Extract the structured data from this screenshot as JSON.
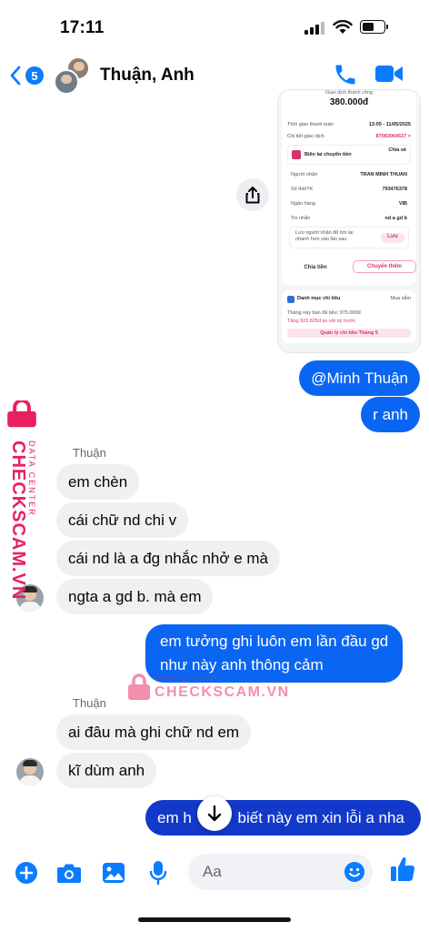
{
  "status_bar": {
    "time": "17:11"
  },
  "header": {
    "back_badge": "5",
    "title": "Thuận, Anh"
  },
  "screenshot": {
    "status": "Giao dịch thành công",
    "amount": "380.000đ",
    "rows": [
      {
        "label": "Thời gian thanh toán",
        "value": "13:05 - 11/05/2025"
      },
      {
        "label": "Chi tiết giao dịch",
        "value": "87083064537 >"
      }
    ],
    "receipt_label": "Biên lai chuyển tiền",
    "receipt_share": "Chia sẻ",
    "details": [
      {
        "label": "Người nhận",
        "value": "TRAN MINH THUAN"
      },
      {
        "label": "Số thẻ/TK",
        "value": "793476378"
      },
      {
        "label": "Ngân hàng",
        "value": "VIB"
      },
      {
        "label": "Tin nhắn",
        "value": "nd a gd b"
      }
    ],
    "save_hint": "Lưu người nhận để tìm lại nhanh hơn vào lần sau.",
    "save_btn": "Lưu",
    "split_btn": "Chia tiền",
    "transfer_more_btn": "Chuyển thêm",
    "spending_label": "Danh mục chi tiêu",
    "spending_category": "Mua sắm",
    "spent_line": "Tháng này bạn đã tiêu: 975.000đ",
    "increase_line": "Tăng 923.825đ so với kỳ trước",
    "manage_btn": "Quản lý chi tiêu Tháng 5"
  },
  "messages": [
    {
      "id": "m1",
      "dir": "out",
      "text": "@Minh Thuận"
    },
    {
      "id": "m2",
      "dir": "out",
      "text": "r anh"
    },
    {
      "id": "m3",
      "dir": "in",
      "sender": "Thuận",
      "text": "em chèn"
    },
    {
      "id": "m4",
      "dir": "in",
      "text": "cái chữ nd chi v"
    },
    {
      "id": "m5",
      "dir": "in",
      "text": "cái nd là a đg nhắc nhở e mà"
    },
    {
      "id": "m6",
      "dir": "in",
      "text": "ngta a gd b. mà em"
    },
    {
      "id": "m7",
      "dir": "out",
      "text": "em tưởng ghi luôn em lần đầu gd như này anh thông cảm"
    },
    {
      "id": "m8",
      "dir": "in",
      "sender": "Thuận",
      "text": "ai đâu mà ghi chữ nd em"
    },
    {
      "id": "m9",
      "dir": "in",
      "text": "kĩ dùm anh"
    },
    {
      "id": "m10",
      "dir": "out",
      "text": "em h mới biết này em xin lỗi a nha"
    }
  ],
  "senders": {
    "thuan_1": "Thuận",
    "thuan_2": "Thuận"
  },
  "bubble_texts": {
    "m7_line1": "em tưởng ghi luôn em lần đầu gd",
    "m7_line2": "như này anh thông cảm",
    "m10_left": "em h",
    "m10_right": "biết này em xin lỗi a nha"
  },
  "watermark": {
    "brand": "CHECKSCAM.VN",
    "sub": "DATA CENTER"
  },
  "composer": {
    "placeholder": "Aa"
  },
  "icons": [
    "back-chevron-icon",
    "phone-icon",
    "video-camera-icon",
    "share-icon",
    "plus-icon",
    "camera-icon",
    "photo-icon",
    "microphone-icon",
    "emoji-icon",
    "thumbs-up-icon",
    "arrow-down-icon",
    "lock-icon"
  ],
  "colors": {
    "accent": "#0a7cff",
    "outgoing": "#0a66f2",
    "outgoing_dark": "#1239c9",
    "incoming": "#eff0f2",
    "watermark": "#e8205e"
  }
}
